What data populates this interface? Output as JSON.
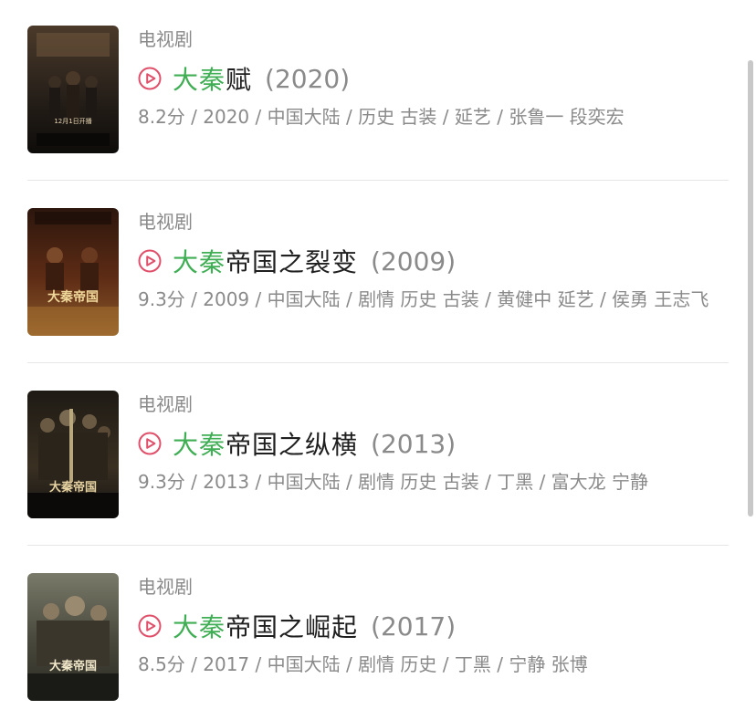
{
  "results": [
    {
      "category": "电视剧",
      "title_highlight": "大秦",
      "title_rest": "赋",
      "year": "(2020)",
      "meta": "8.2分 / 2020 / 中国大陆 / 历史 古装 / 延艺 / 张鲁一 段奕宏",
      "poster_text": "12月1日开播"
    },
    {
      "category": "电视剧",
      "title_highlight": "大秦",
      "title_rest": "帝国之裂变",
      "year": "(2009)",
      "meta": "9.3分 / 2009 / 中国大陆 / 剧情 历史 古装 / 黄健中 延艺 / 侯勇 王志飞",
      "poster_text": "大秦帝国"
    },
    {
      "category": "电视剧",
      "title_highlight": "大秦",
      "title_rest": "帝国之纵横",
      "year": "(2013)",
      "meta": "9.3分 / 2013 / 中国大陆 / 剧情 历史 古装 / 丁黑 / 富大龙 宁静",
      "poster_text": "大秦帝国"
    },
    {
      "category": "电视剧",
      "title_highlight": "大秦",
      "title_rest": "帝国之崛起",
      "year": "(2017)",
      "meta": "8.5分 / 2017 / 中国大陆 / 剧情 历史 / 丁黑 / 宁静 张博",
      "poster_text": "大秦帝国"
    }
  ],
  "colors": {
    "highlight": "#3fae54",
    "play_icon": "#e0506a",
    "muted_text": "#8a8a8a"
  },
  "icons": {
    "play": "play-circle-icon"
  }
}
